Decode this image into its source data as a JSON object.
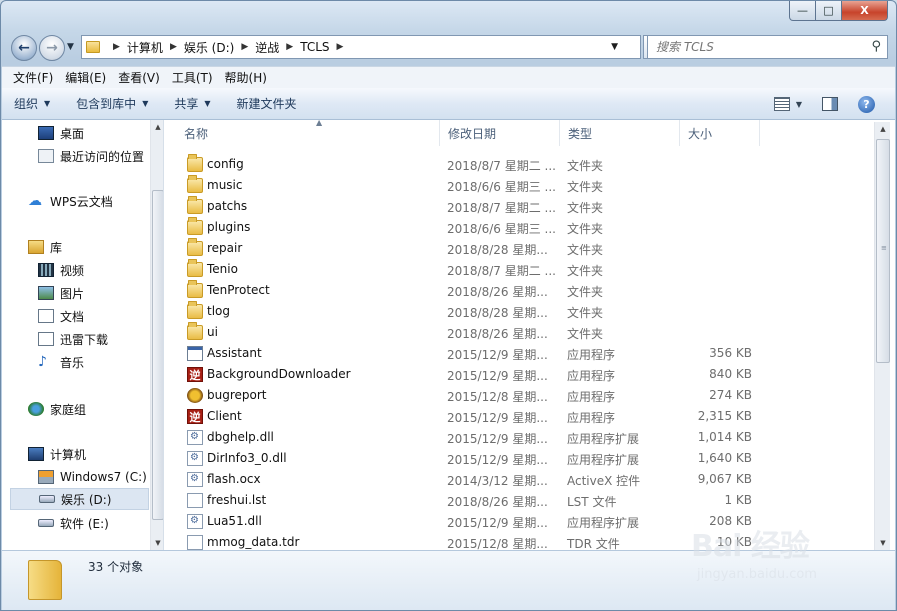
{
  "window": {
    "caption_min": "—",
    "caption_max": "□",
    "caption_close": "X"
  },
  "nav": {
    "back_icon": "arrow-left",
    "forward_icon": "arrow-right",
    "breadcrumb": [
      "计算机",
      "娱乐 (D:)",
      "逆战",
      "TCLS"
    ],
    "search_placeholder": "搜索 TCLS"
  },
  "menu": [
    "文件(F)",
    "编辑(E)",
    "查看(V)",
    "工具(T)",
    "帮助(H)"
  ],
  "commands": {
    "organize": "组织",
    "include_library": "包含到库中",
    "share": "共享",
    "new_folder": "新建文件夹"
  },
  "sidebar": {
    "favorites": [
      {
        "label": "桌面",
        "icon": "desktop-icon"
      },
      {
        "label": "最近访问的位置",
        "icon": "recent-places-icon"
      }
    ],
    "wps": {
      "label": "WPS云文档",
      "icon": "cloud-icon"
    },
    "libraries": {
      "label": "库",
      "items": [
        {
          "label": "视频",
          "icon": "video-icon"
        },
        {
          "label": "图片",
          "icon": "pictures-icon"
        },
        {
          "label": "文档",
          "icon": "documents-icon"
        },
        {
          "label": "迅雷下载",
          "icon": "download-icon"
        },
        {
          "label": "音乐",
          "icon": "music-icon"
        }
      ]
    },
    "homegroup": {
      "label": "家庭组",
      "icon": "homegroup-icon"
    },
    "computer": {
      "label": "计算机",
      "drives": [
        {
          "label": "Windows7 (C:)",
          "icon": "system-drive-icon"
        },
        {
          "label": "娱乐 (D:)",
          "icon": "drive-icon",
          "selected": true
        },
        {
          "label": "软件 (E:)",
          "icon": "drive-icon"
        }
      ]
    }
  },
  "columns": {
    "name": "名称",
    "date": "修改日期",
    "type": "类型",
    "size": "大小"
  },
  "files": [
    {
      "name": "config",
      "date": "2018/8/7 星期二 ...",
      "type": "文件夹",
      "size": "",
      "icon": "folder"
    },
    {
      "name": "music",
      "date": "2018/6/6 星期三 ...",
      "type": "文件夹",
      "size": "",
      "icon": "folder"
    },
    {
      "name": "patchs",
      "date": "2018/8/7 星期二 ...",
      "type": "文件夹",
      "size": "",
      "icon": "folder"
    },
    {
      "name": "plugins",
      "date": "2018/6/6 星期三 ...",
      "type": "文件夹",
      "size": "",
      "icon": "folder"
    },
    {
      "name": "repair",
      "date": "2018/8/28 星期...",
      "type": "文件夹",
      "size": "",
      "icon": "folder"
    },
    {
      "name": "Tenio",
      "date": "2018/8/7 星期二 ...",
      "type": "文件夹",
      "size": "",
      "icon": "folder"
    },
    {
      "name": "TenProtect",
      "date": "2018/8/26 星期...",
      "type": "文件夹",
      "size": "",
      "icon": "folder"
    },
    {
      "name": "tlog",
      "date": "2018/8/28 星期...",
      "type": "文件夹",
      "size": "",
      "icon": "folder"
    },
    {
      "name": "ui",
      "date": "2018/8/26 星期...",
      "type": "文件夹",
      "size": "",
      "icon": "folder"
    },
    {
      "name": "Assistant",
      "date": "2015/12/9 星期...",
      "type": "应用程序",
      "size": "356 KB",
      "icon": "app"
    },
    {
      "name": "BackgroundDownloader",
      "date": "2015/12/9 星期...",
      "type": "应用程序",
      "size": "840 KB",
      "icon": "logo"
    },
    {
      "name": "bugreport",
      "date": "2015/12/8 星期...",
      "type": "应用程序",
      "size": "274 KB",
      "icon": "bug"
    },
    {
      "name": "Client",
      "date": "2015/12/9 星期...",
      "type": "应用程序",
      "size": "2,315 KB",
      "icon": "logo"
    },
    {
      "name": "dbghelp.dll",
      "date": "2015/12/9 星期...",
      "type": "应用程序扩展",
      "size": "1,014 KB",
      "icon": "dll"
    },
    {
      "name": "DirInfo3_0.dll",
      "date": "2015/12/9 星期...",
      "type": "应用程序扩展",
      "size": "1,640 KB",
      "icon": "dll"
    },
    {
      "name": "flash.ocx",
      "date": "2014/3/12 星期...",
      "type": "ActiveX 控件",
      "size": "9,067 KB",
      "icon": "ocx"
    },
    {
      "name": "freshui.lst",
      "date": "2018/8/26 星期...",
      "type": "LST 文件",
      "size": "1 KB",
      "icon": "txt"
    },
    {
      "name": "Lua51.dll",
      "date": "2015/12/9 星期...",
      "type": "应用程序扩展",
      "size": "208 KB",
      "icon": "dll"
    },
    {
      "name": "mmog_data.tdr",
      "date": "2015/12/8 星期...",
      "type": "TDR 文件",
      "size": "10 KB",
      "icon": "txt"
    }
  ],
  "details": {
    "count": "33 个对象"
  },
  "watermark": {
    "main": "Bai 经验",
    "sub": "jingyan.baidu.com"
  }
}
